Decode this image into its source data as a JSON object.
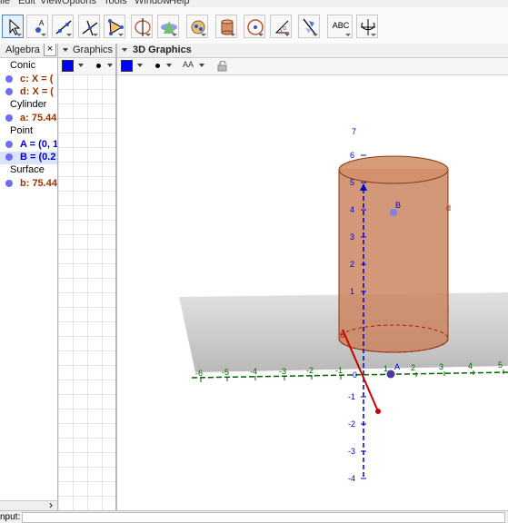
{
  "menu": {
    "items": [
      "ile",
      "Edit",
      "View",
      "Options",
      "Tools",
      "Window",
      "Help"
    ]
  },
  "toolbar": {
    "tools": [
      {
        "name": "move-tool-icon",
        "selected": true
      },
      {
        "name": "point-tool-icon"
      },
      {
        "name": "line-tool-icon"
      },
      {
        "name": "perpendicular-tool-icon"
      },
      {
        "name": "polygon-tool-icon"
      },
      {
        "name": "circle-axis-tool-icon"
      },
      {
        "name": "intersect-surfaces-tool-icon"
      },
      {
        "name": "sphere-tool-icon"
      },
      {
        "name": "cylinder-tool-icon"
      },
      {
        "name": "circle-point-tool-icon"
      },
      {
        "name": "angle-tool-icon"
      },
      {
        "name": "reflect-tool-icon"
      },
      {
        "name": "text-tool",
        "label": "ABC"
      },
      {
        "name": "rotate-view-tool-icon"
      }
    ]
  },
  "algebra": {
    "title": "Algebra",
    "close_glyph": "×",
    "categories": [
      {
        "label": "Conic",
        "items": [
          {
            "text": "c: X = (",
            "color": "#993300"
          },
          {
            "text": "d: X = (",
            "color": "#993300"
          }
        ]
      },
      {
        "label": "Cylinder",
        "items": [
          {
            "text": "a: 75.44",
            "color": "#993300"
          }
        ]
      },
      {
        "label": "Point",
        "items": [
          {
            "text": "A = (0, 1",
            "color": "#0000cc"
          },
          {
            "text": "B = (0.2",
            "color": "#0000cc",
            "highlight": true
          }
        ]
      },
      {
        "label": "Surface",
        "items": [
          {
            "text": "b: 75.44",
            "color": "#993300"
          }
        ]
      }
    ],
    "scroll_glyph": "›"
  },
  "graphics": {
    "title": "Graphics"
  },
  "graphics3d": {
    "title": "3D Graphics",
    "font_btn": "AA"
  },
  "input": {
    "label": "nput:"
  },
  "colors": {
    "cylinder": "#c9805b",
    "axis_blue": "#0000cc",
    "axis_green": "#006600",
    "axis_red": "#cc0000",
    "point": "#5555cc"
  },
  "chart_data": {
    "type": "3d-scene",
    "x_ticks": [
      "-6",
      "-5",
      "-4",
      "-3",
      "-2",
      "-1",
      "1",
      "2",
      "3",
      "4",
      "5"
    ],
    "z_ticks_pos": [
      "1",
      "2",
      "3",
      "4",
      "5",
      "6",
      "7"
    ],
    "z_ticks_neg": [
      "-1",
      "-2",
      "-3",
      "-4"
    ],
    "labels": {
      "origin": "0",
      "point_a": "A",
      "point_b": "B",
      "circle_d": "d",
      "y_axis_end": "6"
    }
  }
}
